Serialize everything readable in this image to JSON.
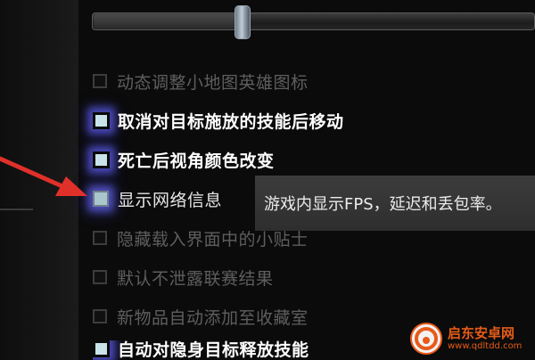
{
  "settings": {
    "slider": {
      "value_fraction": 0.33
    },
    "options": [
      {
        "label": "动态调整小地图英雄图标",
        "checked": false
      },
      {
        "label": "取消对目标施放的技能后移动",
        "checked": true
      },
      {
        "label": "死亡后视角颜色改变",
        "checked": true
      },
      {
        "label": "显示网络信息",
        "checked": false,
        "hovered": true
      },
      {
        "label": "隐藏载入界面中的小贴士",
        "checked": false
      },
      {
        "label": "默认不泄露联赛结果",
        "checked": false
      },
      {
        "label": "新物品自动添加至收藏室",
        "checked": false
      },
      {
        "label": "自动对隐身目标释放技能",
        "checked": true,
        "partial": true
      }
    ],
    "tooltip": "游戏内显示FPS，延迟和丢包率。"
  },
  "watermark": {
    "title": "启东安卓网",
    "url": "www.qdltdd.com"
  },
  "colors": {
    "tooltip_bg": "#353535",
    "checkbox_on": "#c9e3ea",
    "glow": "#5050c8",
    "arrow": "#e0302a",
    "watermark": "#e55b17"
  }
}
